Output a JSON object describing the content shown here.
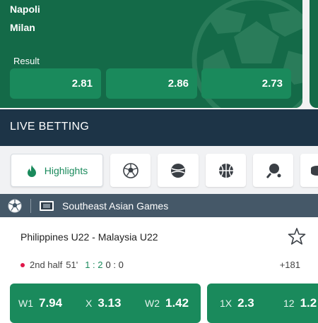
{
  "match": {
    "home_team": "Napoli",
    "away_team": "Milan",
    "result_label": "Result",
    "odds": [
      "2.81",
      "2.86",
      "2.73"
    ]
  },
  "live": {
    "title": "LIVE BETTING"
  },
  "tabs": [
    {
      "label": "Highlights",
      "icon": "flame-icon",
      "active": true
    },
    {
      "icon": "soccer-ball-icon"
    },
    {
      "icon": "tennis-ball-icon"
    },
    {
      "icon": "basketball-icon"
    },
    {
      "icon": "table-tennis-icon"
    },
    {
      "icon": "hockey-puck-icon"
    }
  ],
  "league": {
    "name": "Southeast Asian Games",
    "sport_icon": "soccer-ball-icon",
    "region_icon": "flag-icon"
  },
  "event": {
    "title": "Philippines U22 - Malaysia U22",
    "period": "2nd half",
    "minute": "51'",
    "score": "1 : 2",
    "current_score": "0 : 0",
    "more_markets": "+181",
    "market1": [
      {
        "label": "W1",
        "value": "7.94"
      },
      {
        "label": "X",
        "value": "3.13"
      },
      {
        "label": "W2",
        "value": "1.42"
      }
    ],
    "market2": [
      {
        "label": "1X",
        "value": "2.3"
      },
      {
        "label": "12",
        "value": "1.2"
      }
    ]
  },
  "colors": {
    "brand_green": "#146a48",
    "button_green": "#1a8a5c",
    "header_navy": "#1d3447",
    "league_gray": "#455868",
    "live_dot": "#e0174a"
  }
}
